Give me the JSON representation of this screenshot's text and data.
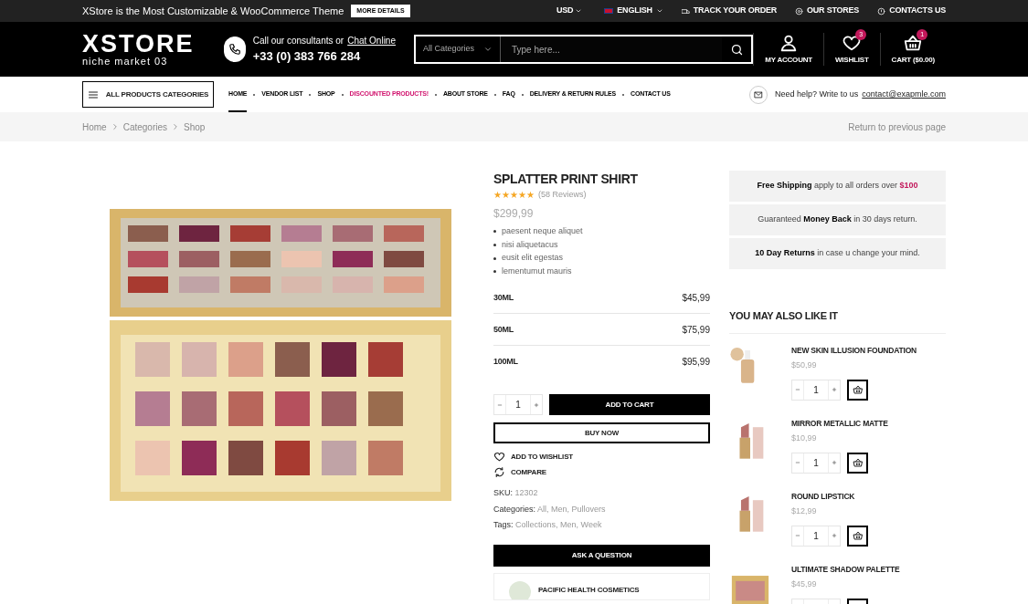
{
  "top_bar": {
    "promo": "XStore is the Most Customizable & WooCommerce Theme",
    "promo_button": "MORE DETAILS",
    "currency": "USD",
    "language": "ENGLISH",
    "links": [
      "TRACK YOUR ORDER",
      "OUR STORES",
      "CONTACTS US"
    ]
  },
  "header": {
    "logo": "XSTORE",
    "logo_sub": "niche market 03",
    "consult_text": "Call our consultants or",
    "consult_link": "Chat Online",
    "phone": "+33 (0) 383 766 284",
    "search": {
      "category": "All Categories",
      "placeholder": "Type here..."
    },
    "account": "MY ACCOUNT",
    "wishlist": {
      "label": "WISHLIST",
      "count": "3"
    },
    "cart": {
      "label": "CART ($0.00)",
      "count": "1"
    }
  },
  "nav": {
    "categories_button": "ALL PRODUCTS CATEGORIES",
    "items": [
      {
        "label": "HOME",
        "selected": true,
        "highlighted": false
      },
      {
        "label": "VENDOR LIST",
        "selected": false,
        "highlighted": false
      },
      {
        "label": "SHOP",
        "selected": false,
        "highlighted": false
      },
      {
        "label": "DISCOUNTED PRODUCTS!",
        "selected": false,
        "highlighted": true
      },
      {
        "label": "ABOUT STORE",
        "selected": false,
        "highlighted": false
      },
      {
        "label": "FAQ",
        "selected": false,
        "highlighted": false
      },
      {
        "label": "DELIVERY & RETURN RULES",
        "selected": false,
        "highlighted": false
      },
      {
        "label": "CONTACT US",
        "selected": false,
        "highlighted": false
      }
    ],
    "help_text": "Need help? Write to us",
    "help_email": "contact@exapmle.com"
  },
  "breadcrumb": {
    "items": [
      "Home",
      "Categories",
      "Shop"
    ],
    "return_link": "Return to previous page"
  },
  "product": {
    "title": "SPLATTER PRINT SHIRT",
    "stars": 5,
    "reviews": "(58 Reviews)",
    "price": "$299,99",
    "features": [
      "paesent neque aliquet",
      "nisi aliquetacus",
      "eusit elit egestas",
      "lementumut mauris"
    ],
    "variants": [
      {
        "label": "30ML",
        "price": "$45,99"
      },
      {
        "label": "50ML",
        "price": "$75,99"
      },
      {
        "label": "100ML",
        "price": "$95,99"
      }
    ],
    "quantity": "1",
    "add_to_cart": "ADD TO CART",
    "buy_now": "BUY NOW",
    "wishlist": "ADD TO WISHLIST",
    "compare": "COMPARE",
    "meta": [
      {
        "label": "SKU:",
        "value": "12302"
      },
      {
        "label": "Categories:",
        "value": "All, Men, Pullovers"
      },
      {
        "label": "Tags:",
        "value": "Collections, Men, Week"
      }
    ],
    "ask_question": "ASK A QUESTION",
    "vendor": "PACIFIC HEALTH COSMETICS"
  },
  "info_boxes": [
    [
      {
        "text": "Free Shipping",
        "bold": true,
        "accent": false
      },
      {
        "text": " apply to all orders over ",
        "bold": false,
        "accent": false
      },
      {
        "text": "$100",
        "bold": true,
        "accent": true
      }
    ],
    [
      {
        "text": "Guaranteed ",
        "bold": false,
        "accent": false
      },
      {
        "text": "Money Back",
        "bold": true,
        "accent": false
      },
      {
        "text": " in 30 days return.",
        "bold": false,
        "accent": false
      }
    ],
    [
      {
        "text": "10 Day Returns",
        "bold": true,
        "accent": false
      },
      {
        "text": " in case u change your mind.",
        "bold": false,
        "accent": false
      }
    ]
  ],
  "related": {
    "title": "YOU MAY ALSO LIKE IT",
    "items": [
      {
        "name": "NEW SKIN ILLUSION FOUNDATION",
        "price": "$50,99",
        "quantity": "1",
        "kind": "bottle"
      },
      {
        "name": "MIRROR METALLIC MATTE",
        "price": "$10,99",
        "quantity": "1",
        "kind": "lipstick"
      },
      {
        "name": "ROUND LIPSTICK",
        "price": "$12,99",
        "quantity": "1",
        "kind": "lipstick"
      },
      {
        "name": "ULTIMATE SHADOW PALETTE",
        "price": "$45,99",
        "kind": "palette"
      }
    ]
  }
}
